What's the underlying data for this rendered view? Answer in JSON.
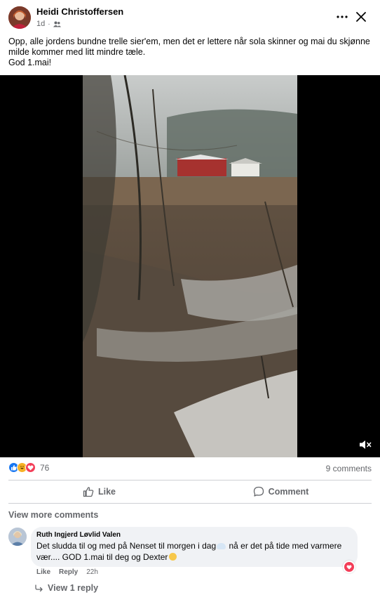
{
  "post": {
    "author": "Heidi Christoffersen",
    "time": "1d",
    "separator": "·",
    "audience_icon": "friends-icon",
    "text_lines": [
      "Opp, alle jordens bundne trelle sier'em, men det er lettere når sola skinner og mai du skjønne",
      "milde kommer med litt mindre tæle.",
      "God 1.mai!"
    ]
  },
  "header": {
    "more_icon": "more-horizontal-icon",
    "close_icon": "close-icon"
  },
  "video": {
    "volume_icon": "volume-muted-icon"
  },
  "stats": {
    "reaction_types": [
      "like",
      "haha",
      "love"
    ],
    "reaction_count": "76",
    "comment_count": "9 comments"
  },
  "actions": {
    "like_label": "Like",
    "comment_label": "Comment"
  },
  "comments": {
    "view_more_label": "View more comments",
    "items": [
      {
        "author": "Ruth Ingjerd Løvlid Valen",
        "text_part1": "Det sludda til og med på Nenset til morgen i dag",
        "text_part2": " nå er det på tide med varmere",
        "text_line2": "vær.... GOD 1.mai til deg og Dexter",
        "like_label": "Like",
        "reply_label": "Reply",
        "time": "22h",
        "reaction": "love",
        "view_reply_label": "View 1 reply"
      }
    ]
  },
  "colors": {
    "text": "#050505",
    "secondary_text": "#65676b",
    "like_blue": "#1877f2",
    "love_red": "#f33e58",
    "haha_yellow": "#f7b125",
    "bubble_bg": "#f0f2f5",
    "divider": "#ced0d4"
  }
}
